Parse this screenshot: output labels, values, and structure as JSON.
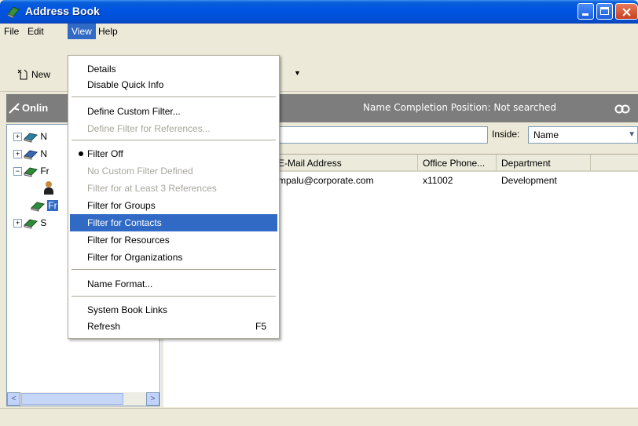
{
  "window": {
    "title": "Address Book"
  },
  "menubar": [
    {
      "label": "File"
    },
    {
      "label": "Edit"
    },
    {
      "label": "View"
    },
    {
      "label": "Help"
    }
  ],
  "toolbar": {
    "new_label": "New"
  },
  "online_bar": {
    "label": "Onlin",
    "name_completion": "Name Completion Position:  Not searched"
  },
  "search": {
    "inside_label": "Inside:",
    "inside_value": "Name"
  },
  "tree": {
    "items": [
      {
        "label": "N"
      },
      {
        "label": "N"
      },
      {
        "label": "Fr"
      },
      {
        "label": "Fr"
      },
      {
        "label": "S"
      }
    ]
  },
  "list": {
    "columns": [
      {
        "label": "E-Mail Address"
      },
      {
        "label": "Office Phone..."
      },
      {
        "label": "Department"
      }
    ],
    "rows": [
      {
        "email": "mpalu@corporate.com",
        "phone": "x11002",
        "department": "Development"
      }
    ]
  },
  "view_menu": {
    "items": [
      {
        "label": "Details"
      },
      {
        "label": "Disable Quick Info"
      },
      {
        "label": "Define Custom Filter..."
      },
      {
        "label": "Define Filter for References..."
      },
      {
        "label": "Filter Off"
      },
      {
        "label": "No Custom Filter Defined"
      },
      {
        "label": "Filter for at Least 3 References"
      },
      {
        "label": "Filter for Groups"
      },
      {
        "label": "Filter for Contacts"
      },
      {
        "label": "Filter for Resources"
      },
      {
        "label": "Filter for Organizations"
      },
      {
        "label": "Name Format..."
      },
      {
        "label": "System Book Links"
      },
      {
        "label": "Refresh",
        "shortcut": "F5"
      }
    ]
  },
  "colors": {
    "titlebar": "#0054e3",
    "highlight": "#316ac5",
    "online_bar": "#7d7d7d"
  }
}
